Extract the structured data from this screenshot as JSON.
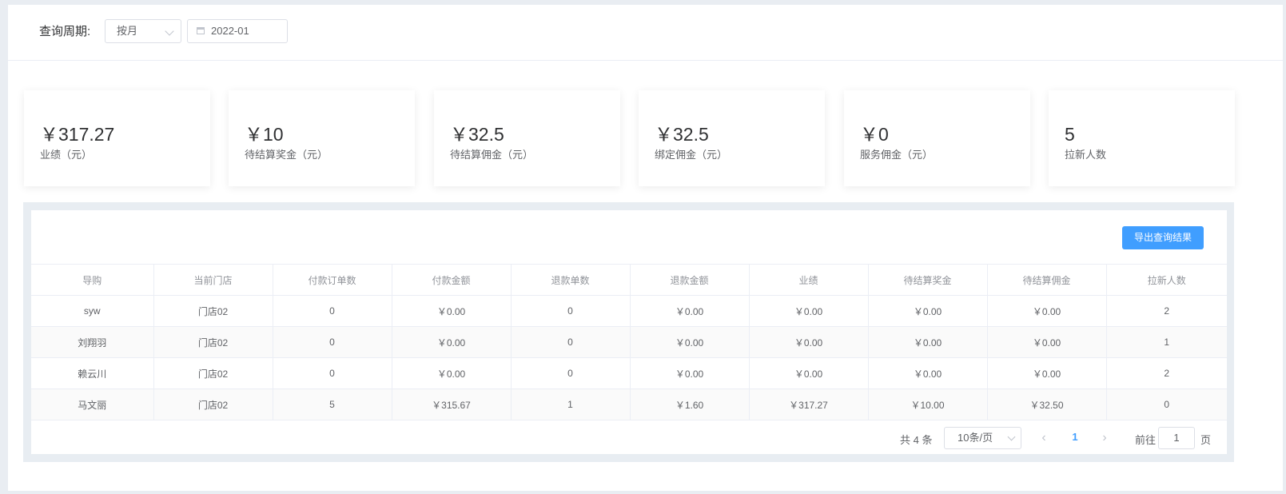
{
  "filter": {
    "label": "查询周期:",
    "period": "按月",
    "date": "2022-01"
  },
  "stats": [
    {
      "value": "￥317.27",
      "label": "业绩（元）"
    },
    {
      "value": "￥10",
      "label": "待结算奖金（元）"
    },
    {
      "value": "￥32.5",
      "label": "待结算佣金（元）"
    },
    {
      "value": "￥32.5",
      "label": "绑定佣金（元）"
    },
    {
      "value": "￥0",
      "label": "服务佣金（元）"
    },
    {
      "value": "5",
      "label": "拉新人数"
    }
  ],
  "export_label": "导出查询结果",
  "table": {
    "columns": [
      "导购",
      "当前门店",
      "付款订单数",
      "付款金额",
      "退款单数",
      "退款金额",
      "业绩",
      "待结算奖金",
      "待结算佣金",
      "拉新人数"
    ],
    "rows": [
      [
        "syw",
        "门店02",
        "0",
        "￥0.00",
        "0",
        "￥0.00",
        "￥0.00",
        "￥0.00",
        "￥0.00",
        "2"
      ],
      [
        "刘翔羽",
        "门店02",
        "0",
        "￥0.00",
        "0",
        "￥0.00",
        "￥0.00",
        "￥0.00",
        "￥0.00",
        "1"
      ],
      [
        "赖云川",
        "门店02",
        "0",
        "￥0.00",
        "0",
        "￥0.00",
        "￥0.00",
        "￥0.00",
        "￥0.00",
        "2"
      ],
      [
        "马文丽",
        "门店02",
        "5",
        "￥315.67",
        "1",
        "￥1.60",
        "￥317.27",
        "￥10.00",
        "￥32.50",
        "0"
      ]
    ]
  },
  "pager": {
    "total": "共 4 条",
    "page_size": "10条/页",
    "prev_icon": "‹",
    "next_icon": "›",
    "current": "1",
    "goto_label": "前往",
    "goto_value": "1",
    "page_suffix": "页"
  }
}
